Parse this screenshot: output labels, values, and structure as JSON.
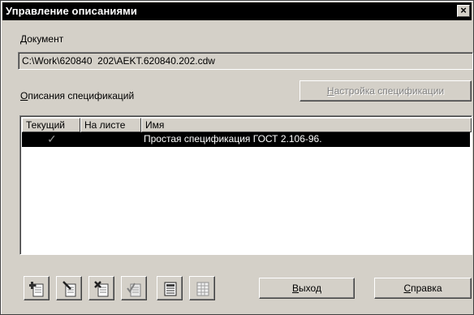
{
  "window": {
    "title": "Управление описаниями",
    "close_glyph": "×"
  },
  "document": {
    "label": "Документ",
    "path": "C:\\Work\\620840  202\\AEKT.620840.202.cdw"
  },
  "specs": {
    "label_underlined": "О",
    "label_rest": "писания спецификаций",
    "settings_button_underlined": "Н",
    "settings_button_rest": "астройка спецификации",
    "columns": [
      "Текущий",
      "На листе",
      "Имя"
    ],
    "rows": [
      {
        "current_mark": "✓",
        "on_sheet": "",
        "name": "Простая спецификация ГОСТ 2.106-96."
      }
    ]
  },
  "toolbar": {
    "icons": [
      "add-spec-icon",
      "edit-spec-icon",
      "delete-spec-icon",
      "check-spec-icon",
      "sheet-spec-icon",
      "grid-spec-icon"
    ]
  },
  "buttons": {
    "exit_underlined": "В",
    "exit_rest": "ыход",
    "help_underlined": "С",
    "help_rest": "правка"
  },
  "colors": {
    "window_bg": "#d4d0c8",
    "title_bg": "#000000",
    "selection_bg": "#000000"
  }
}
